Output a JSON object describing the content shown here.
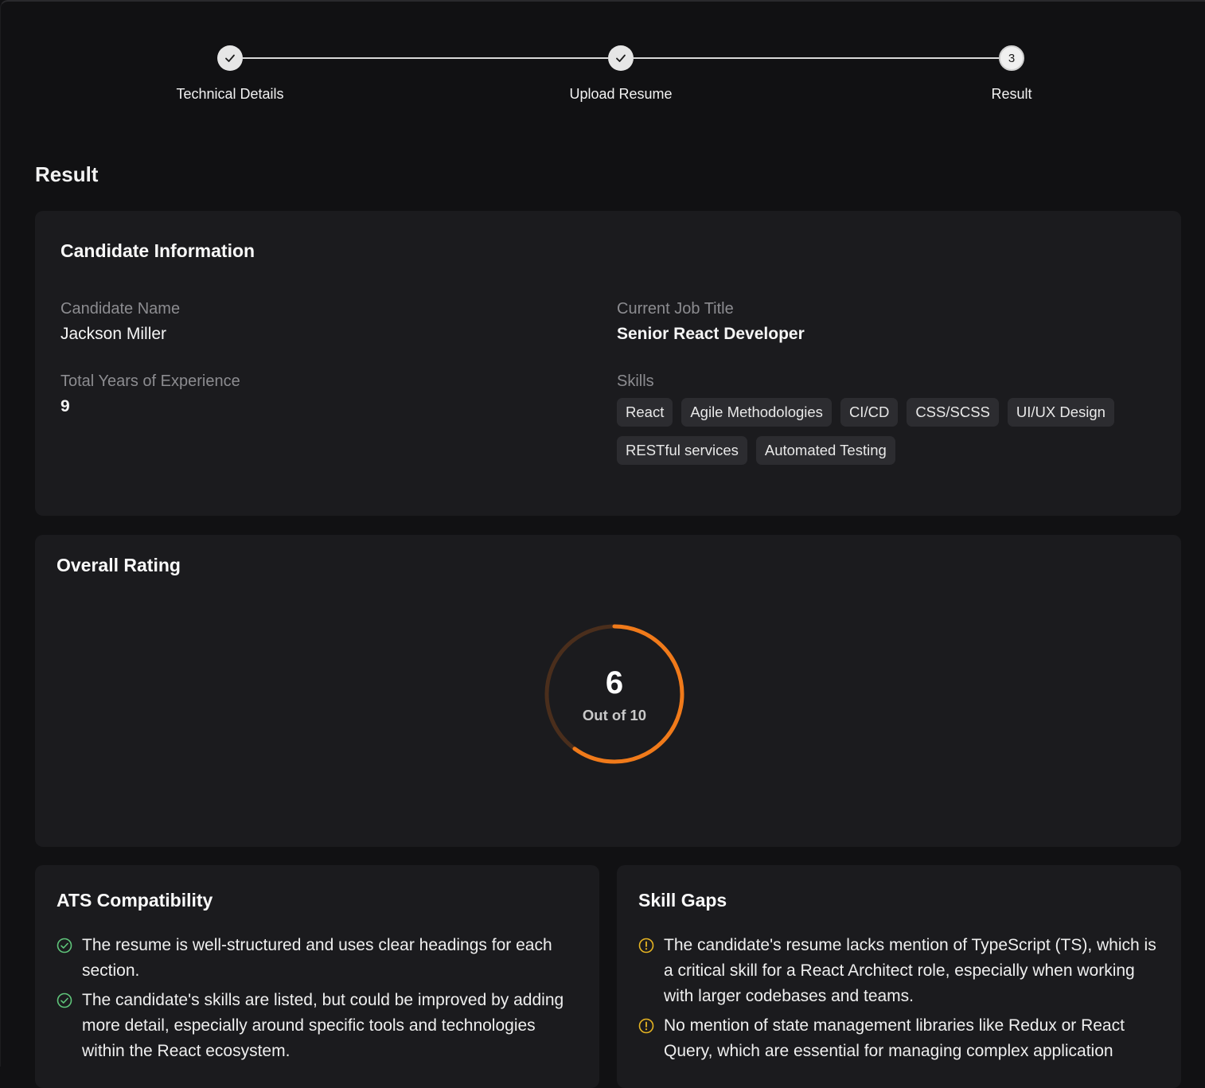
{
  "stepper": {
    "steps": [
      {
        "label": "Technical Details",
        "state": "done",
        "icon": "check-icon"
      },
      {
        "label": "Upload Resume",
        "state": "done",
        "icon": "check-icon"
      },
      {
        "label": "Result",
        "state": "current",
        "number": "3"
      }
    ]
  },
  "page": {
    "title": "Result"
  },
  "candidate": {
    "title": "Candidate Information",
    "name_label": "Candidate Name",
    "name": "Jackson Miller",
    "job_label": "Current Job Title",
    "job": "Senior React Developer",
    "exp_label": "Total Years of Experience",
    "exp": "9",
    "skills_label": "Skills",
    "skills": [
      "React",
      "Agile Methodologies",
      "CI/CD",
      "CSS/SCSS",
      "UI/UX Design",
      "RESTful services",
      "Automated Testing"
    ]
  },
  "rating": {
    "title": "Overall Rating",
    "value": "6",
    "subtitle": "Out of 10",
    "score": 6,
    "max": 10,
    "accent": "#f07a1a",
    "track": "#4a2e1c"
  },
  "ats": {
    "title": "ATS Compatibility",
    "icon": "check-circle-icon",
    "color": "#5fc47a",
    "items": [
      "The resume is well-structured and uses clear headings for each section.",
      "The candidate's skills are listed, but could be improved by adding more detail, especially around specific tools and technologies within the React ecosystem."
    ]
  },
  "gaps": {
    "title": "Skill Gaps",
    "icon": "warning-circle-icon",
    "color": "#e6b422",
    "items": [
      "The candidate's resume lacks mention of TypeScript (TS), which is a critical skill for a React Architect role, especially when working with larger codebases and teams.",
      "No mention of state management libraries like Redux or React Query, which are essential for managing complex application"
    ]
  }
}
